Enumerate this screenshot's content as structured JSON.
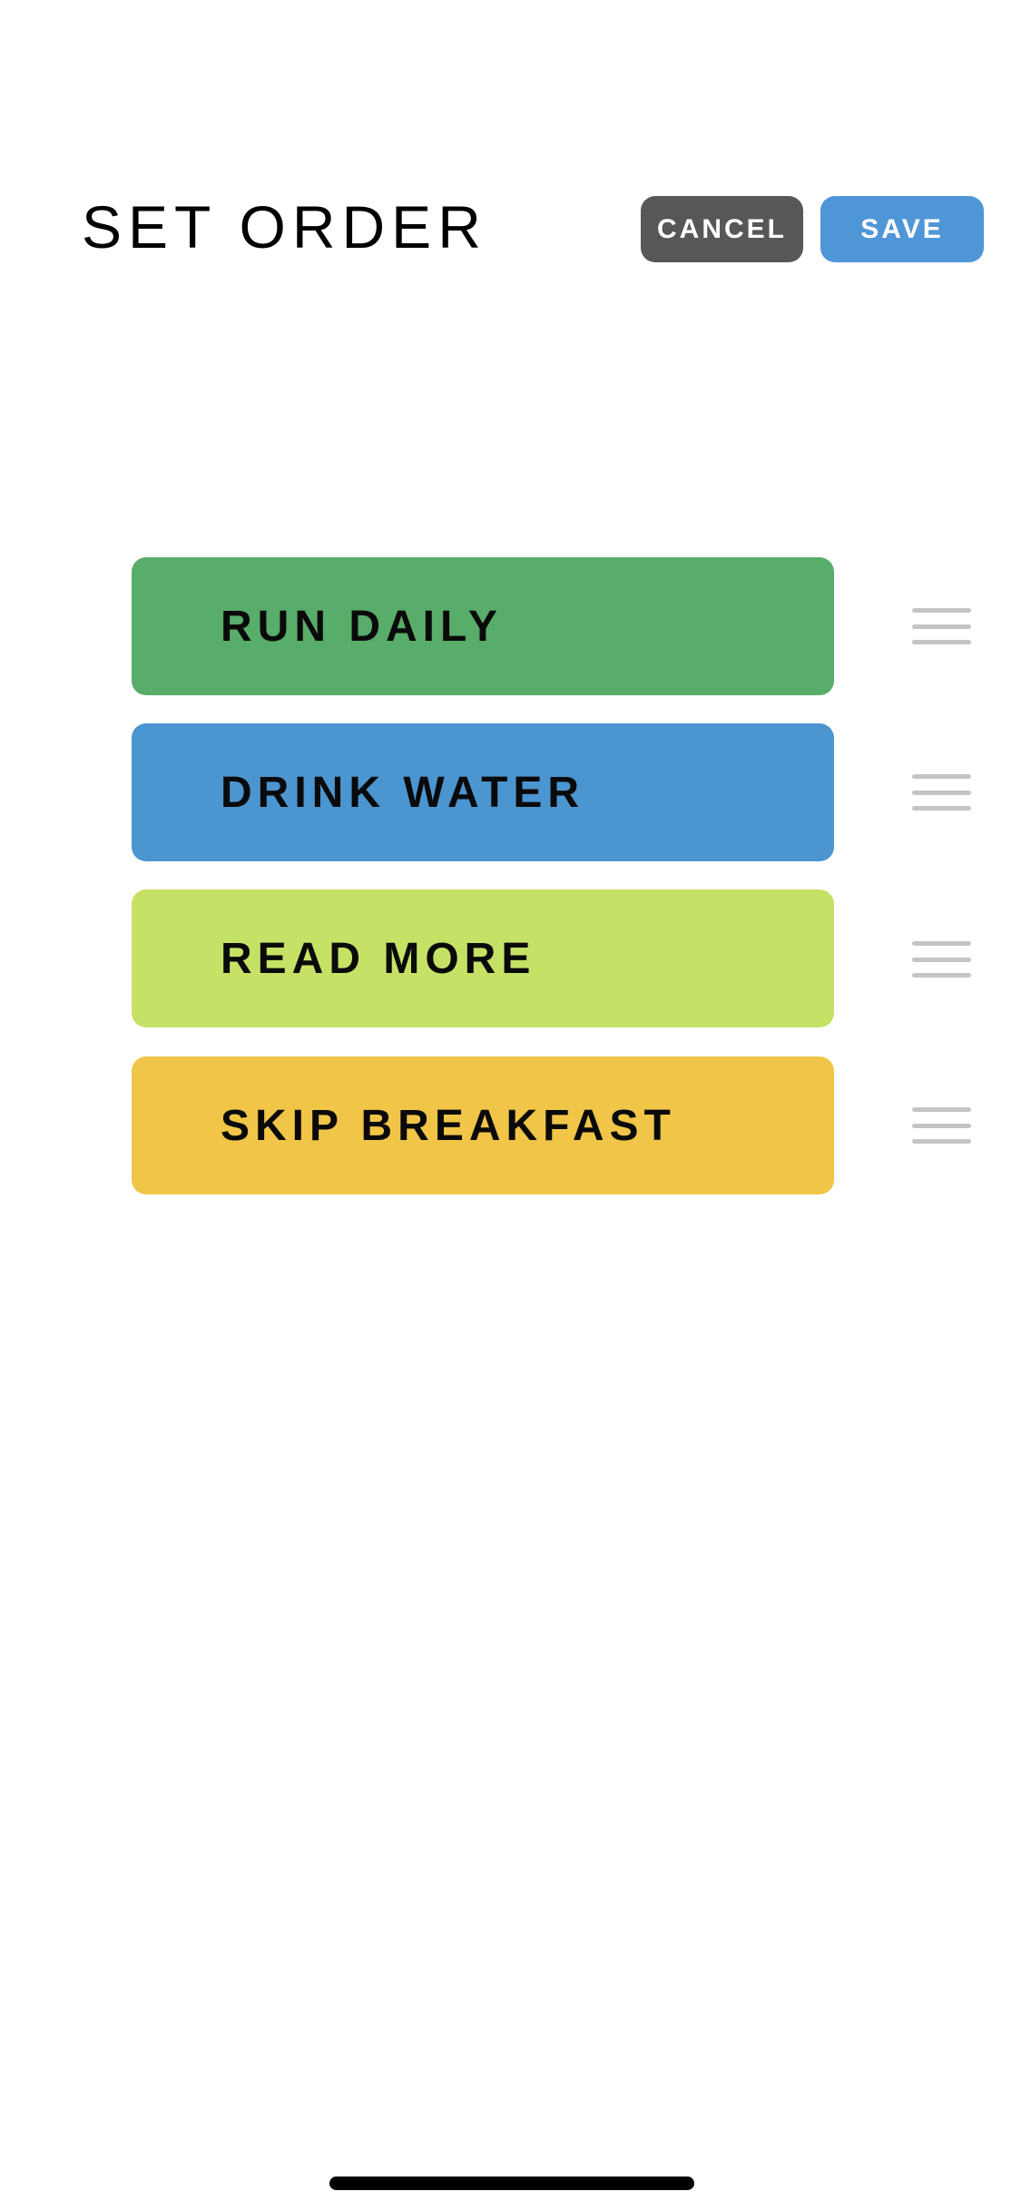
{
  "header": {
    "title": "SET ORDER",
    "cancel_label": "CANCEL",
    "save_label": "SAVE"
  },
  "colors": {
    "cancel": "#575757",
    "save": "#4f96d7"
  },
  "items": [
    {
      "label": "RUN DAILY",
      "color": "#57ad69",
      "handle_icon": "drag-handle-icon"
    },
    {
      "label": "DRINK WATER",
      "color": "#4b95d0",
      "handle_icon": "drag-handle-icon"
    },
    {
      "label": "READ MORE",
      "color": "#c6e266",
      "handle_icon": "drag-handle-icon"
    },
    {
      "label": "SKIP BREAKFAST",
      "color": "#f0c548",
      "handle_icon": "drag-handle-icon"
    }
  ]
}
